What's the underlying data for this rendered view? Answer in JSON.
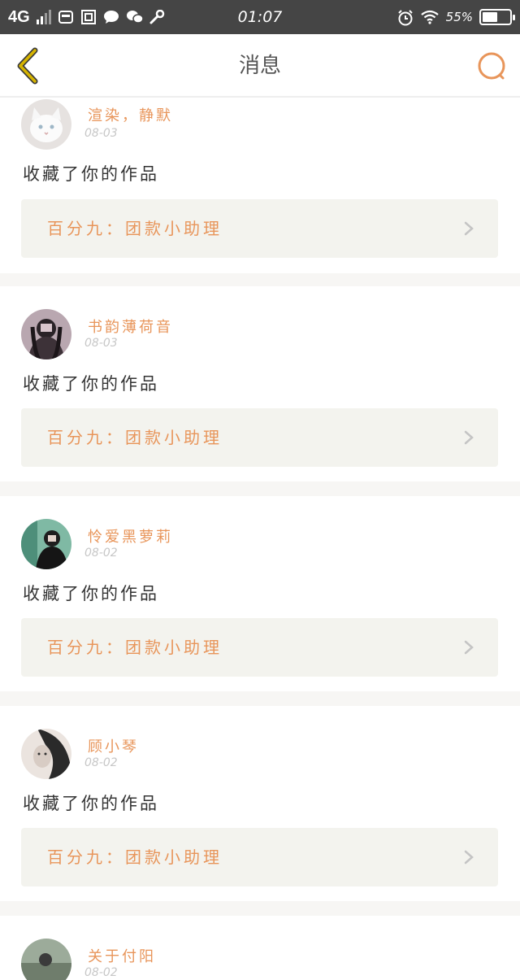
{
  "status_bar": {
    "network": "4G",
    "time": "01:07",
    "battery_percent": "55%",
    "battery_level": 0.55,
    "icons": [
      "signal-icon",
      "bag-icon",
      "image-icon",
      "chat-bubble-icon",
      "wechat-icon",
      "wrench-icon",
      "alarm-icon",
      "wifi-icon",
      "battery-icon"
    ]
  },
  "nav": {
    "title": "消息",
    "back_icon": "chevron-left-icon",
    "search_icon": "search-icon"
  },
  "colors": {
    "accent_orange": "#e8955a",
    "back_yellow": "#d6b400",
    "background": "#f7f6f4",
    "ref_box": "#f3f3ee"
  },
  "messages": [
    {
      "username": "渲染，静默",
      "date": "08-03",
      "action": "收藏了你的作品",
      "ref": "百分九：团款小助理"
    },
    {
      "username": "书韵薄荷音",
      "date": "08-03",
      "action": "收藏了你的作品",
      "ref": "百分九：团款小助理"
    },
    {
      "username": "怜爱黑萝莉",
      "date": "08-02",
      "action": "收藏了你的作品",
      "ref": "百分九：团款小助理"
    },
    {
      "username": "顾小琴",
      "date": "08-02",
      "action": "收藏了你的作品",
      "ref": "百分九：团款小助理"
    },
    {
      "username": "关于付阳",
      "date": "08-02"
    }
  ]
}
